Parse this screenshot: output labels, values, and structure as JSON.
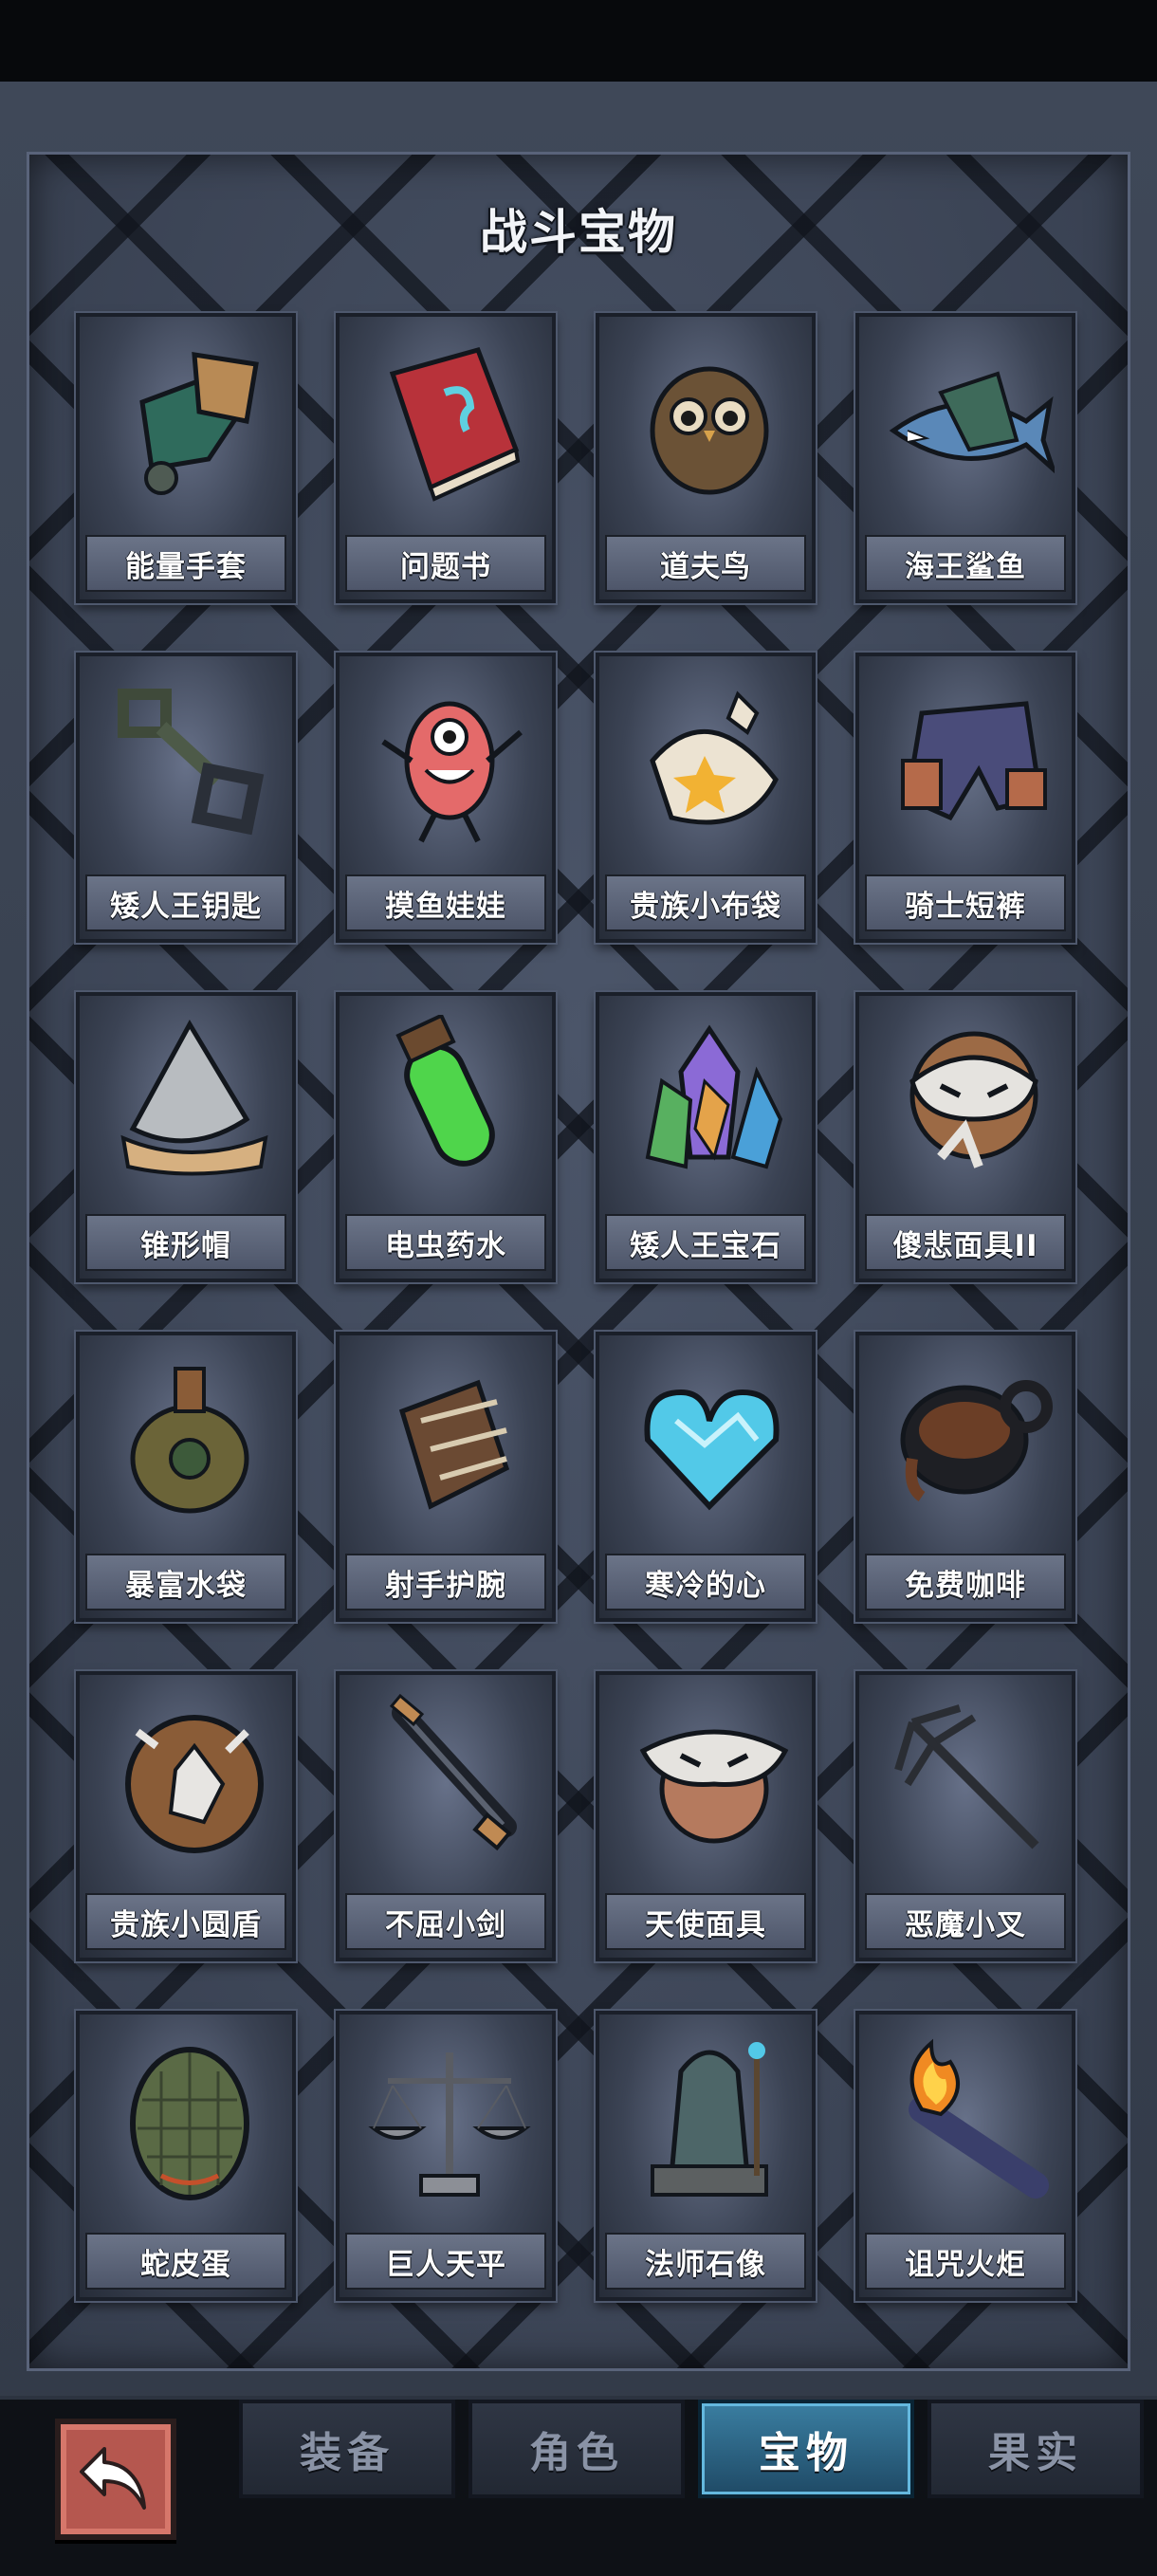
{
  "screen": {
    "title": "战斗宝物"
  },
  "treasures": [
    {
      "label": "能量手套",
      "icon": "gauntlet-icon"
    },
    {
      "label": "问题书",
      "icon": "book-icon"
    },
    {
      "label": "道夫鸟",
      "icon": "owl-icon"
    },
    {
      "label": "海王鲨鱼",
      "icon": "shark-icon"
    },
    {
      "label": "矮人王钥匙",
      "icon": "key-icon"
    },
    {
      "label": "摸鱼娃娃",
      "icon": "doll-icon"
    },
    {
      "label": "贵族小布袋",
      "icon": "pouch-icon"
    },
    {
      "label": "骑士短裤",
      "icon": "shorts-icon"
    },
    {
      "label": "锥形帽",
      "icon": "helmet-icon"
    },
    {
      "label": "电虫药水",
      "icon": "potion-icon"
    },
    {
      "label": "矮人王宝石",
      "icon": "gem-icon"
    },
    {
      "label": "傻悲面具II",
      "icon": "mask-icon"
    },
    {
      "label": "暴富水袋",
      "icon": "waterskin-icon"
    },
    {
      "label": "射手护腕",
      "icon": "bracer-icon"
    },
    {
      "label": "寒冷的心",
      "icon": "ice-heart-icon"
    },
    {
      "label": "免费咖啡",
      "icon": "coffee-icon"
    },
    {
      "label": "贵族小圆盾",
      "icon": "shield-icon"
    },
    {
      "label": "不屈小剑",
      "icon": "sword-icon"
    },
    {
      "label": "天使面具",
      "icon": "angel-mask-icon"
    },
    {
      "label": "恶魔小叉",
      "icon": "trident-icon"
    },
    {
      "label": "蛇皮蛋",
      "icon": "egg-icon"
    },
    {
      "label": "巨人天平",
      "icon": "scales-icon"
    },
    {
      "label": "法师石像",
      "icon": "statue-icon"
    },
    {
      "label": "诅咒火炬",
      "icon": "torch-icon"
    }
  ],
  "nav": {
    "back_icon": "back-arrow-icon",
    "tabs": [
      {
        "label": "装备",
        "active": false
      },
      {
        "label": "角色",
        "active": false
      },
      {
        "label": "宝物",
        "active": true
      },
      {
        "label": "果实",
        "active": false
      }
    ]
  },
  "colors": {
    "panel": "#3d4659",
    "active_tab": "#3a7ea1",
    "back_button": "#b5574f"
  }
}
